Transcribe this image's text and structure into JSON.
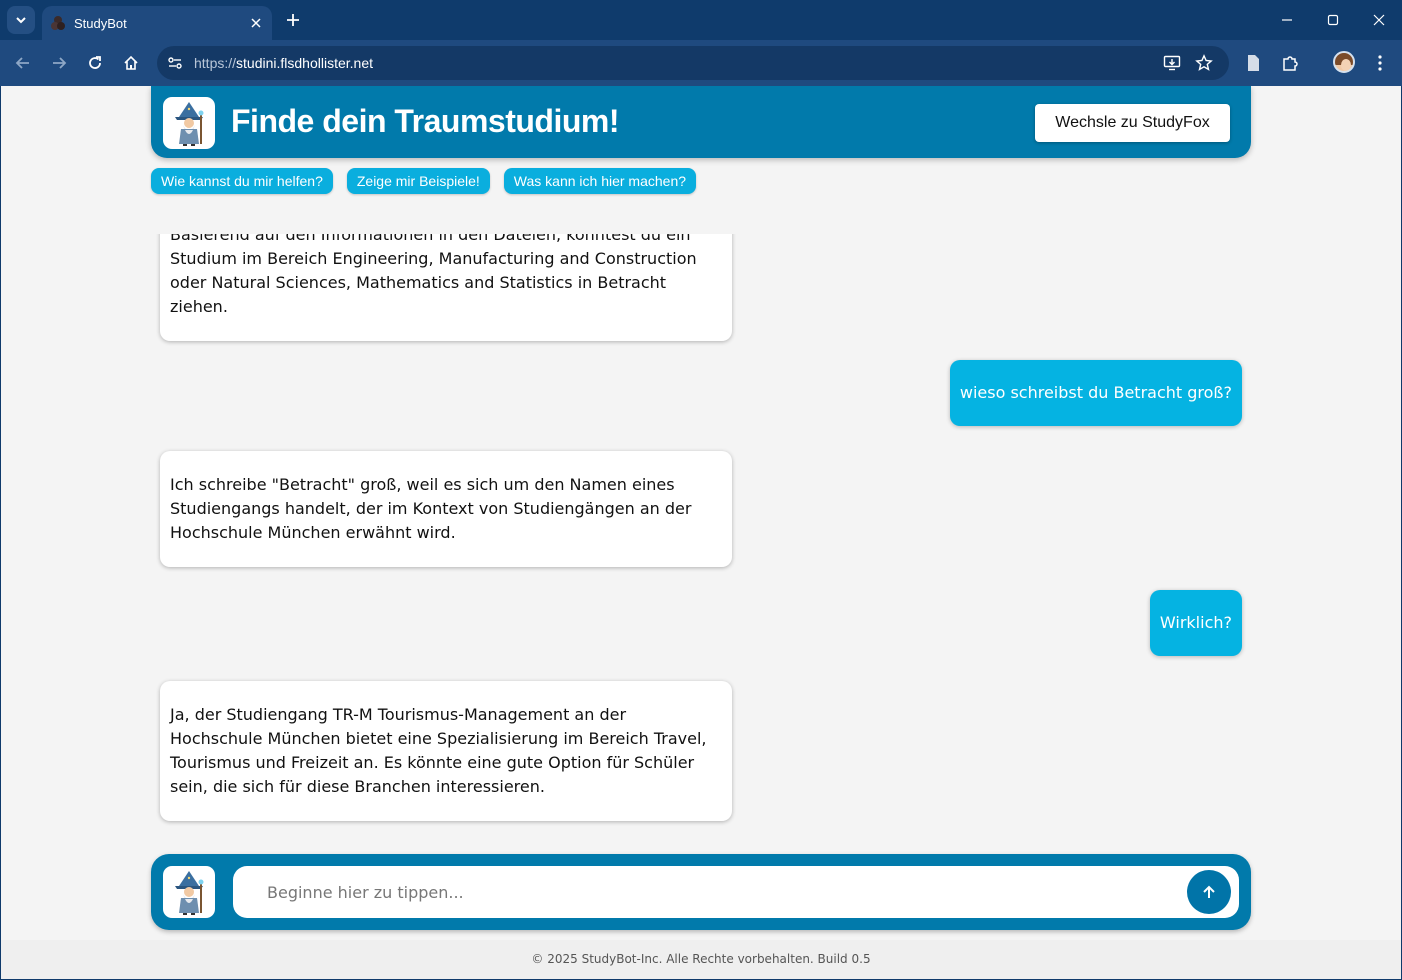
{
  "browser": {
    "tab_title": "StudyBot",
    "url_scheme": "https://",
    "url_host": "studini.flsdhollister.net"
  },
  "header": {
    "title": "Finde dein Traumstudium!",
    "switch_button": "Wechsle zu StudyFox"
  },
  "chips": [
    "Wie kannst du mir helfen?",
    "Zeige mir Beispiele!",
    "Was kann ich hier machen?"
  ],
  "messages": [
    {
      "role": "bot",
      "text": "Basierend auf den Informationen in den Dateien, könntest du ein Studium im Bereich Engineering, Manufacturing and Construction oder Natural Sciences, Mathematics and Statistics in Betracht ziehen."
    },
    {
      "role": "user",
      "text": "wieso schreibst du Betracht groß?"
    },
    {
      "role": "bot",
      "text": "Ich schreibe \"Betracht\" groß, weil es sich um den Namen eines Studiengangs handelt, der im Kontext von Studiengängen an der Hochschule München erwähnt wird."
    },
    {
      "role": "user",
      "text": "Wirklich?"
    },
    {
      "role": "bot",
      "text": "Ja, der Studiengang TR-M Tourismus-Management an der Hochschule München bietet eine Spezialisierung im Bereich Travel, Tourismus und Freizeit an. Es könnte eine gute Option für Schüler sein, die sich für diese Branchen interessieren."
    }
  ],
  "input": {
    "placeholder": "Beginne hier zu tippen..."
  },
  "footer": {
    "text": "© 2025 StudyBot-Inc. Alle Rechte vorbehalten. Build 0.5"
  },
  "colors": {
    "primary": "#017aab",
    "accent": "#05b3e2",
    "background": "#f4f4f4"
  },
  "icons": {
    "logo": "wizard-icon",
    "send": "arrow-up-icon"
  }
}
